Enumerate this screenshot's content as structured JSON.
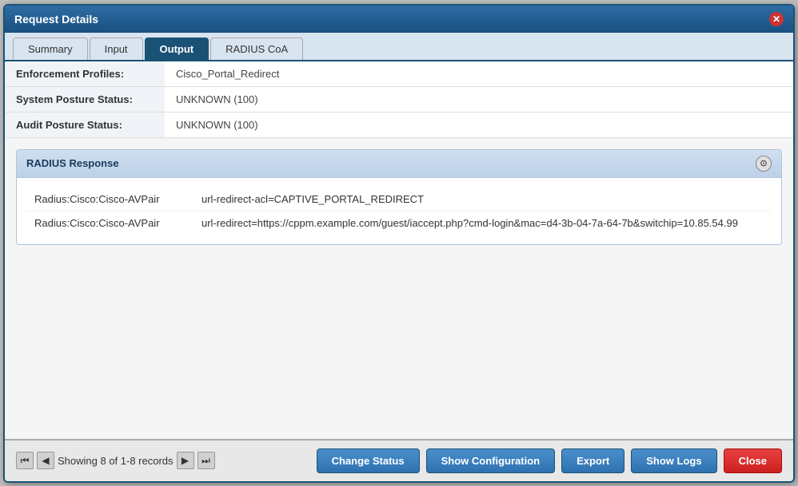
{
  "dialog": {
    "title": "Request Details",
    "close_label": "✕"
  },
  "tabs": [
    {
      "id": "summary",
      "label": "Summary",
      "active": false
    },
    {
      "id": "input",
      "label": "Input",
      "active": false
    },
    {
      "id": "output",
      "label": "Output",
      "active": true
    },
    {
      "id": "radius-coa",
      "label": "RADIUS CoA",
      "active": false
    }
  ],
  "fields": [
    {
      "label": "Enforcement Profiles:",
      "value": "Cisco_Portal_Redirect"
    },
    {
      "label": "System Posture Status:",
      "value": "UNKNOWN (100)"
    },
    {
      "label": "Audit Posture Status:",
      "value": "UNKNOWN (100)"
    }
  ],
  "radius_section": {
    "header": "RADIUS Response",
    "toggle_icon": "⊙",
    "rows": [
      {
        "key": "Radius:Cisco:Cisco-AVPair",
        "value": "url-redirect-acl=CAPTIVE_PORTAL_REDIRECT"
      },
      {
        "key": "Radius:Cisco:Cisco-AVPair",
        "value": "url-redirect=https://cppm.example.com/guest/iaccept.php?cmd-login&mac=d4-3b-04-7a-64-7b&switchip=10.85.54.99"
      }
    ]
  },
  "footer": {
    "pager": {
      "first": "⏮",
      "prev": "◀",
      "text": "Showing 8 of 1-8 records",
      "next": "▶",
      "last": "⏭"
    },
    "buttons": [
      {
        "id": "change-status",
        "label": "Change Status",
        "style": "blue"
      },
      {
        "id": "show-configuration",
        "label": "Show Configuration",
        "style": "blue"
      },
      {
        "id": "export",
        "label": "Export",
        "style": "blue"
      },
      {
        "id": "show-logs",
        "label": "Show Logs",
        "style": "blue"
      },
      {
        "id": "close",
        "label": "Close",
        "style": "red"
      }
    ]
  }
}
